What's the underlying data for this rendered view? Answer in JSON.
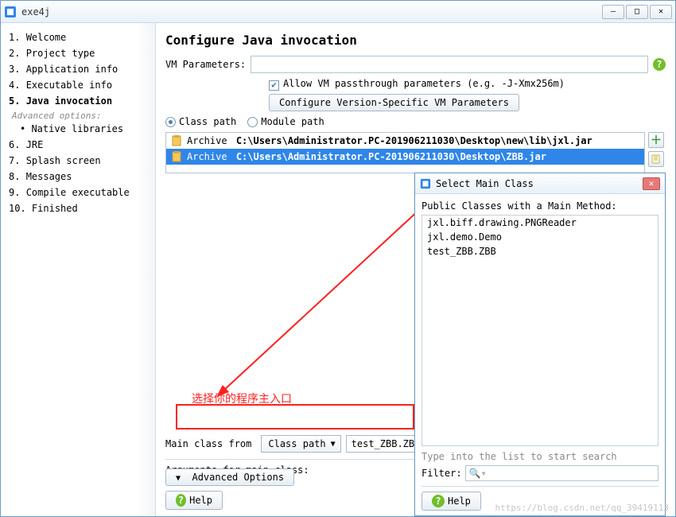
{
  "window": {
    "title": "exe4j"
  },
  "brand": "exe4j",
  "sidebar": {
    "steps": [
      {
        "num": "1.",
        "label": "Welcome"
      },
      {
        "num": "2.",
        "label": "Project type"
      },
      {
        "num": "3.",
        "label": "Application info"
      },
      {
        "num": "4.",
        "label": "Executable info"
      },
      {
        "num": "5.",
        "label": "Java invocation",
        "current": true
      },
      {
        "num": "6.",
        "label": "JRE"
      },
      {
        "num": "7.",
        "label": "Splash screen"
      },
      {
        "num": "8.",
        "label": "Messages"
      },
      {
        "num": "9.",
        "label": "Compile executable"
      },
      {
        "num": "10.",
        "label": "Finished"
      }
    ],
    "advanced_label": "Advanced options:",
    "advanced_sub": "Native libraries"
  },
  "main": {
    "heading": "Configure Java invocation",
    "vm_params_label": "VM Parameters:",
    "allow_passthrough": "Allow VM passthrough parameters (e.g. -J-Xmx256m)",
    "configure_button": "Configure Version-Specific VM Parameters",
    "radio_classpath": "Class path",
    "radio_modulepath": "Module path",
    "archives": [
      {
        "label": "Archive",
        "path": "C:\\Users\\Administrator.PC-201906211030\\Desktop\\new\\lib\\jxl.jar",
        "selected": false
      },
      {
        "label": "Archive",
        "path": "C:\\Users\\Administrator.PC-201906211030\\Desktop\\ZBB.jar",
        "selected": true
      }
    ],
    "main_class_label": "Main class from",
    "main_class_dropdown": "Class path",
    "main_class_value": "test_ZBB.ZBB",
    "args_label": "Arguments for main class:",
    "advanced_button": "Advanced Options",
    "help_button": "Help"
  },
  "dialog": {
    "title": "Select Main Class",
    "subtitle": "Public Classes with a Main Method:",
    "classes": [
      "jxl.biff.drawing.PNGReader",
      "jxl.demo.Demo",
      "test_ZBB.ZBB"
    ],
    "hint": "Type into the list to start search",
    "filter_label": "Filter:",
    "help_button": "Help"
  },
  "annotation": "选择你的程序主入口",
  "watermark": "https://blog.csdn.net/qq_39419113"
}
